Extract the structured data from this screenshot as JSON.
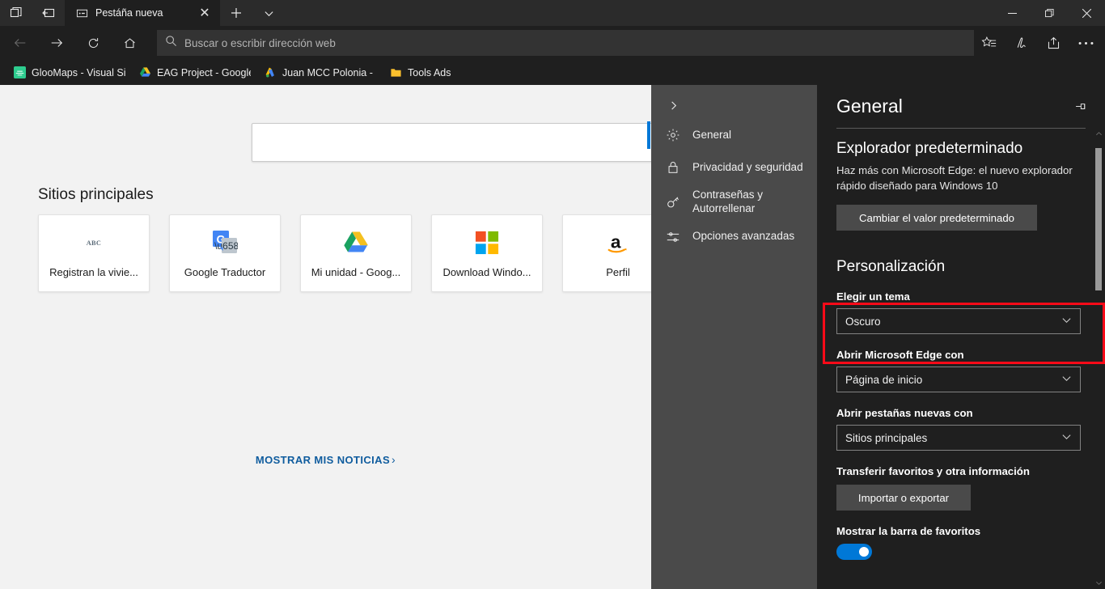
{
  "window": {
    "titlebar": {
      "tab_list_button": "tab-list",
      "set_aside_button": "set-tabs-aside",
      "new_tab_button": "+",
      "tab_menu_button": "tab-actions-menu"
    },
    "controls": {
      "minimize": "—",
      "maximize": "❐",
      "close": "✕"
    }
  },
  "tabs": [
    {
      "title": "Pestáña nueva",
      "favicon": "newtab-icon",
      "active": true,
      "close_label": "✕"
    }
  ],
  "navbar": {
    "back_label": "Atrás",
    "forward_label": "Adelante",
    "refresh_label": "Actualizar",
    "home_label": "Inicio",
    "address": {
      "value": "",
      "placeholder": "Buscar o escribir dirección web"
    },
    "tools": [
      {
        "name": "favorites-icon",
        "label": "Favoritos"
      },
      {
        "name": "notes-icon",
        "label": "Notas web"
      },
      {
        "name": "share-icon",
        "label": "Compartir"
      },
      {
        "name": "more-icon",
        "label": "Configuración y más"
      }
    ]
  },
  "favorites_bar": [
    {
      "label": "GlooMaps - Visual Sit",
      "icon": "gloomaps-icon"
    },
    {
      "label": "EAG Project - Google",
      "icon": "google-drive-icon"
    },
    {
      "label": "Juan MCC Polonia - G",
      "icon": "google-ads-icon"
    },
    {
      "label": "Tools Ads",
      "icon": "folder-icon"
    }
  ],
  "newtab": {
    "search": {
      "value": "",
      "placeholder": ""
    },
    "top_sites_title": "Sitios principales",
    "tiles": [
      {
        "label": "Registran la vivie...",
        "icon": "abc-icon"
      },
      {
        "label": "Google Traductor",
        "icon": "google-translate-icon"
      },
      {
        "label": "Mi unidad - Goog...",
        "icon": "google-drive-icon"
      },
      {
        "label": "Download Windo...",
        "icon": "microsoft-icon"
      },
      {
        "label": "Perfil",
        "icon": "amazon-icon"
      }
    ],
    "news_link": "MOSTRAR MIS NOTICIAS",
    "news_chevron": "›"
  },
  "settings": {
    "collapse_label": "›",
    "nav": [
      {
        "label": "General",
        "icon": "gear-icon",
        "active": true
      },
      {
        "label": "Privacidad y seguridad",
        "icon": "lock-icon",
        "active": false
      },
      {
        "label": "Contraseñas y Autorrellenar",
        "icon": "key-icon",
        "active": false
      },
      {
        "label": "Opciones avanzadas",
        "icon": "sliders-icon",
        "active": false
      }
    ],
    "title": "General",
    "pin_label": "Anclar",
    "default_browser": {
      "heading": "Explorador predeterminado",
      "description": "Haz más con Microsoft Edge: el nuevo explorador rápido diseñado para Windows 10",
      "button": "Cambiar el valor predeterminado"
    },
    "personalization": {
      "heading": "Personalización",
      "theme_label": "Elegir un tema",
      "theme_value": "Oscuro",
      "open_edge_label": "Abrir Microsoft Edge con",
      "open_edge_value": "Página de inicio",
      "new_tabs_label": "Abrir pestañas nuevas con",
      "new_tabs_value": "Sitios principales",
      "transfer_label": "Transferir favoritos y otra información",
      "transfer_button": "Importar o exportar",
      "favbar_label": "Mostrar la barra de favoritos",
      "favbar_enabled": "Activado"
    },
    "highlight_color": "#fb0a18",
    "accent_color": "#0078d7"
  }
}
